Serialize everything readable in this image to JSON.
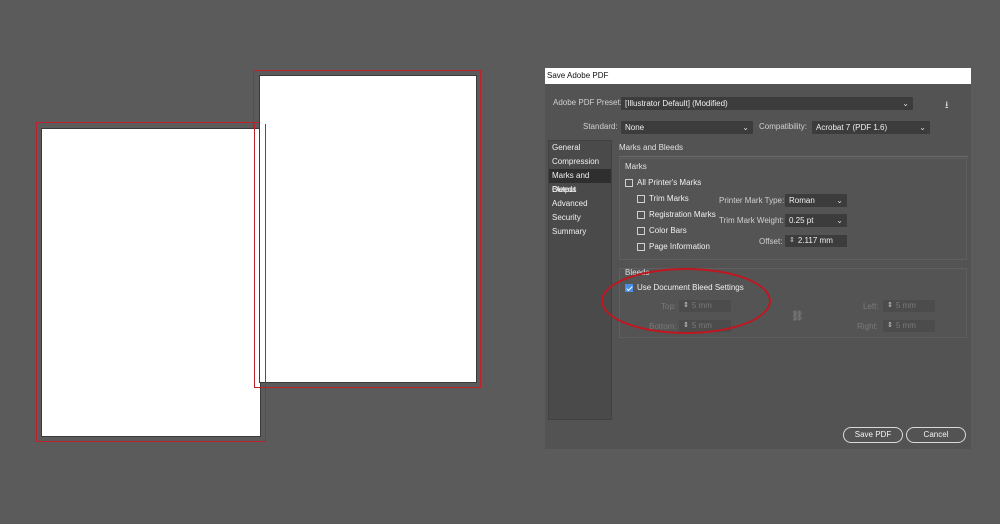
{
  "dialog": {
    "title": "Save Adobe PDF",
    "preset_label": "Adobe PDF Preset:",
    "preset_value": "[Illustrator Default] (Modified)",
    "standard_label": "Standard:",
    "standard_value": "None",
    "compat_label": "Compatibility:",
    "compat_value": "Acrobat 7 (PDF 1.6)",
    "sidebar": [
      "General",
      "Compression",
      "Marks and Bleeds",
      "Output",
      "Advanced",
      "Security",
      "Summary"
    ],
    "active_item": "Marks and Bleeds",
    "panel_title": "Marks and Bleeds",
    "marks": {
      "title": "Marks",
      "all_printers": "All Printer's Marks",
      "trim": "Trim Marks",
      "registration": "Registration Marks",
      "color_bars": "Color Bars",
      "page_info": "Page Information",
      "mark_type_label": "Printer Mark Type:",
      "mark_type_value": "Roman",
      "weight_label": "Trim Mark Weight:",
      "weight_value": "0.25 pt",
      "offset_label": "Offset:",
      "offset_value": "2.117 mm"
    },
    "bleeds": {
      "title": "Bleeds",
      "use_doc": "Use Document Bleed Settings",
      "top_label": "Top:",
      "top_value": "5 mm",
      "bottom_label": "Bottom:",
      "bottom_value": "5 mm",
      "left_label": "Left:",
      "left_value": "5 mm",
      "right_label": "Right:",
      "right_value": "5 mm"
    },
    "save_label": "Save PDF",
    "cancel_label": "Cancel",
    "colors": {
      "accent": "#4a8fe6",
      "highlight_circle": "#c1161f",
      "bleed_line": "#c0202a"
    }
  }
}
